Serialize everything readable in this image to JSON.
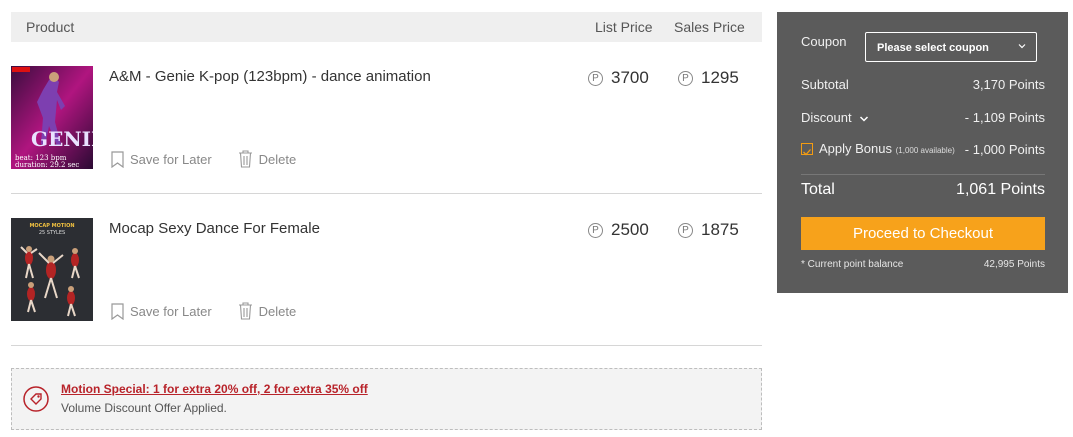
{
  "header": {
    "product": "Product",
    "list_price": "List Price",
    "sales_price": "Sales Price"
  },
  "items": [
    {
      "name": "A&M - Genie K-pop (123bpm) - dance animation",
      "list_price": "3700",
      "sales_price": "1295",
      "thumb_caption_1": "beat: 123 bpm",
      "thumb_caption_2": "duration: 29.2 sec",
      "thumb_title": "GENIE",
      "save_label": "Save for Later",
      "delete_label": "Delete"
    },
    {
      "name": "Mocap Sexy Dance For Female",
      "list_price": "2500",
      "sales_price": "1875",
      "thumb_title": "MOCAP MOTION",
      "thumb_subtitle": "25 STYLES",
      "save_label": "Save for Later",
      "delete_label": "Delete"
    }
  ],
  "point_symbol": "P",
  "promo": {
    "link": "Motion Special: 1 for extra 20% off, 2 for extra 35% off",
    "note": "Volume Discount Offer Applied."
  },
  "summary": {
    "coupon_label": "Coupon",
    "coupon_placeholder": "Please select coupon",
    "subtotal_label": "Subtotal",
    "subtotal_value": "3,170 Points",
    "discount_label": "Discount",
    "discount_value": "- 1,109 Points",
    "bonus_label": "Apply Bonus",
    "bonus_available": "(1,000 available)",
    "bonus_value": "- 1,000 Points",
    "bonus_checked": true,
    "total_label": "Total",
    "total_value": "1,061 Points",
    "checkout_label": "Proceed to Checkout",
    "balance_label": "* Current point balance",
    "balance_value": "42,995 Points"
  },
  "colors": {
    "panel_bg": "#5b5b5b",
    "checkout_bg": "#f7a21b",
    "promo_link": "#b8232a",
    "header_bg": "#efefef"
  }
}
